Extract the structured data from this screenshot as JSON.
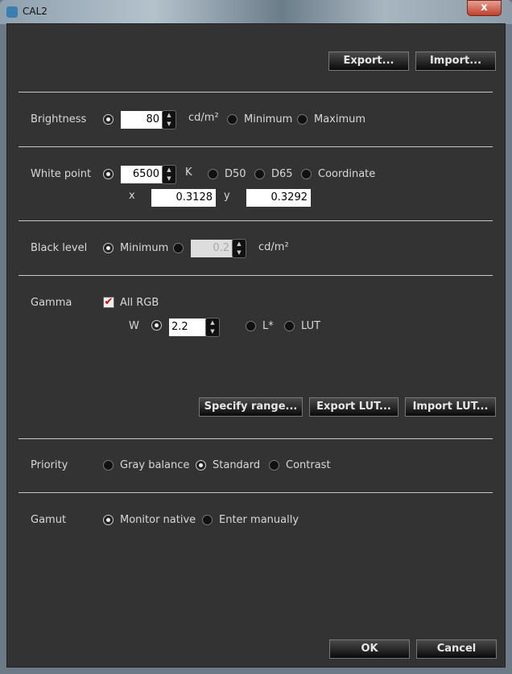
{
  "window": {
    "title": "CAL2",
    "close": "x"
  },
  "top_buttons": {
    "export": "Export...",
    "import": "Import..."
  },
  "brightness": {
    "label": "Brightness",
    "value": "80",
    "unit": "cd/m²",
    "options": [
      "Minimum",
      "Maximum"
    ],
    "selected": "value"
  },
  "white_point": {
    "label": "White point",
    "value": "6500",
    "unit": "K",
    "options": [
      "D50",
      "D65",
      "Coordinate"
    ],
    "selected": "value",
    "x_label": "x",
    "x_value": "0.3128",
    "y_label": "y",
    "y_value": "0.3292"
  },
  "black_level": {
    "label": "Black level",
    "option_min": "Minimum",
    "value": "0.2",
    "unit": "cd/m²",
    "selected": "Minimum"
  },
  "gamma": {
    "label": "Gamma",
    "all_rgb": "All RGB",
    "all_rgb_checked": true,
    "channel": "W",
    "value": "2.2",
    "options": [
      "L*",
      "LUT"
    ],
    "selected": "value",
    "buttons": [
      "Specify range...",
      "Export LUT...",
      "Import LUT..."
    ]
  },
  "priority": {
    "label": "Priority",
    "options": [
      "Gray balance",
      "Standard",
      "Contrast"
    ],
    "selected": "Standard"
  },
  "gamut": {
    "label": "Gamut",
    "options": [
      "Monitor native",
      "Enter manually"
    ],
    "selected": "Monitor native"
  },
  "footer": {
    "ok": "OK",
    "cancel": "Cancel"
  },
  "colors": {
    "background": "#333333",
    "checkmark": "#dd0000"
  }
}
